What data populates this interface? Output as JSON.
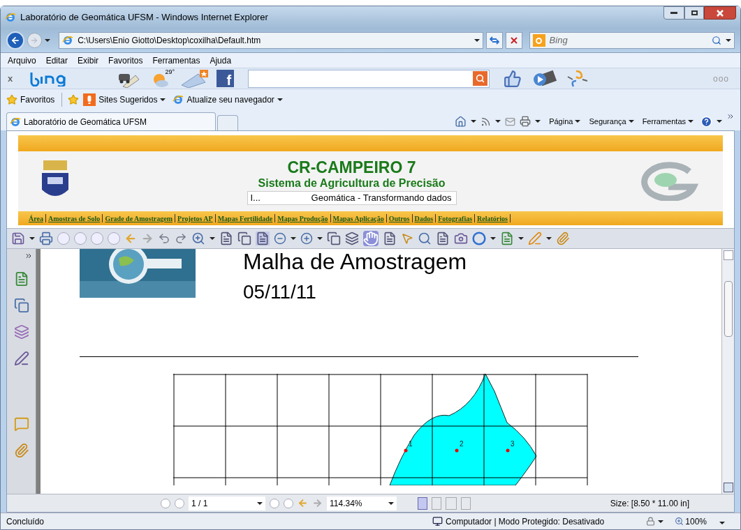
{
  "window": {
    "title": "Laboratório de Geomática UFSM - Windows Internet Explorer"
  },
  "address": {
    "value": "C:\\Users\\Enio Giotto\\Desktop\\coxilha\\Default.htm"
  },
  "search": {
    "placeholder": "Bing"
  },
  "menu": [
    "Arquivo",
    "Editar",
    "Exibir",
    "Favoritos",
    "Ferramentas",
    "Ajuda"
  ],
  "bing_toolbar": {
    "close": "x",
    "temperature": "29°",
    "facebook": "f",
    "more": "ooo"
  },
  "favorites_bar": [
    {
      "label": "Favoritos",
      "dropdown": false
    },
    {
      "label": "Sites Sugeridos",
      "dropdown": true
    },
    {
      "label": "Atualize seu navegador",
      "dropdown": true
    }
  ],
  "tabs": [
    {
      "label": "Laboratório de Geomática UFSM",
      "selected": true
    }
  ],
  "command_bar": [
    "Página",
    "Segurança",
    "Ferramentas"
  ],
  "site": {
    "title": "CR-CAMPEIRO 7",
    "subtitle": "Sistema de Agricultura de Precisão",
    "marquee_start": "I...",
    "marquee_text": "Geomática - Transformando dados",
    "nav": [
      "Área",
      "Amostras de Solo",
      "Grade de Amostragem",
      "Projetos AP",
      "Mapas Fertilidade",
      "Mapas Produção",
      "Mapas Aplicação",
      "Outros",
      "Dados",
      "Fotografias",
      "Relatórios"
    ]
  },
  "pdf": {
    "doc_title": "Malha de Amostragem",
    "date": "05/11/11",
    "points": [
      {
        "label": "1"
      },
      {
        "label": "2"
      },
      {
        "label": "3"
      }
    ],
    "page": "1 / 1",
    "zoom": "114.34%",
    "size": "Size: [8.50 * 11.00 in]"
  },
  "status_bar": {
    "text": "Concluído",
    "zone": "Computador | Modo Protegido: Desativado",
    "zoom": "100%"
  }
}
